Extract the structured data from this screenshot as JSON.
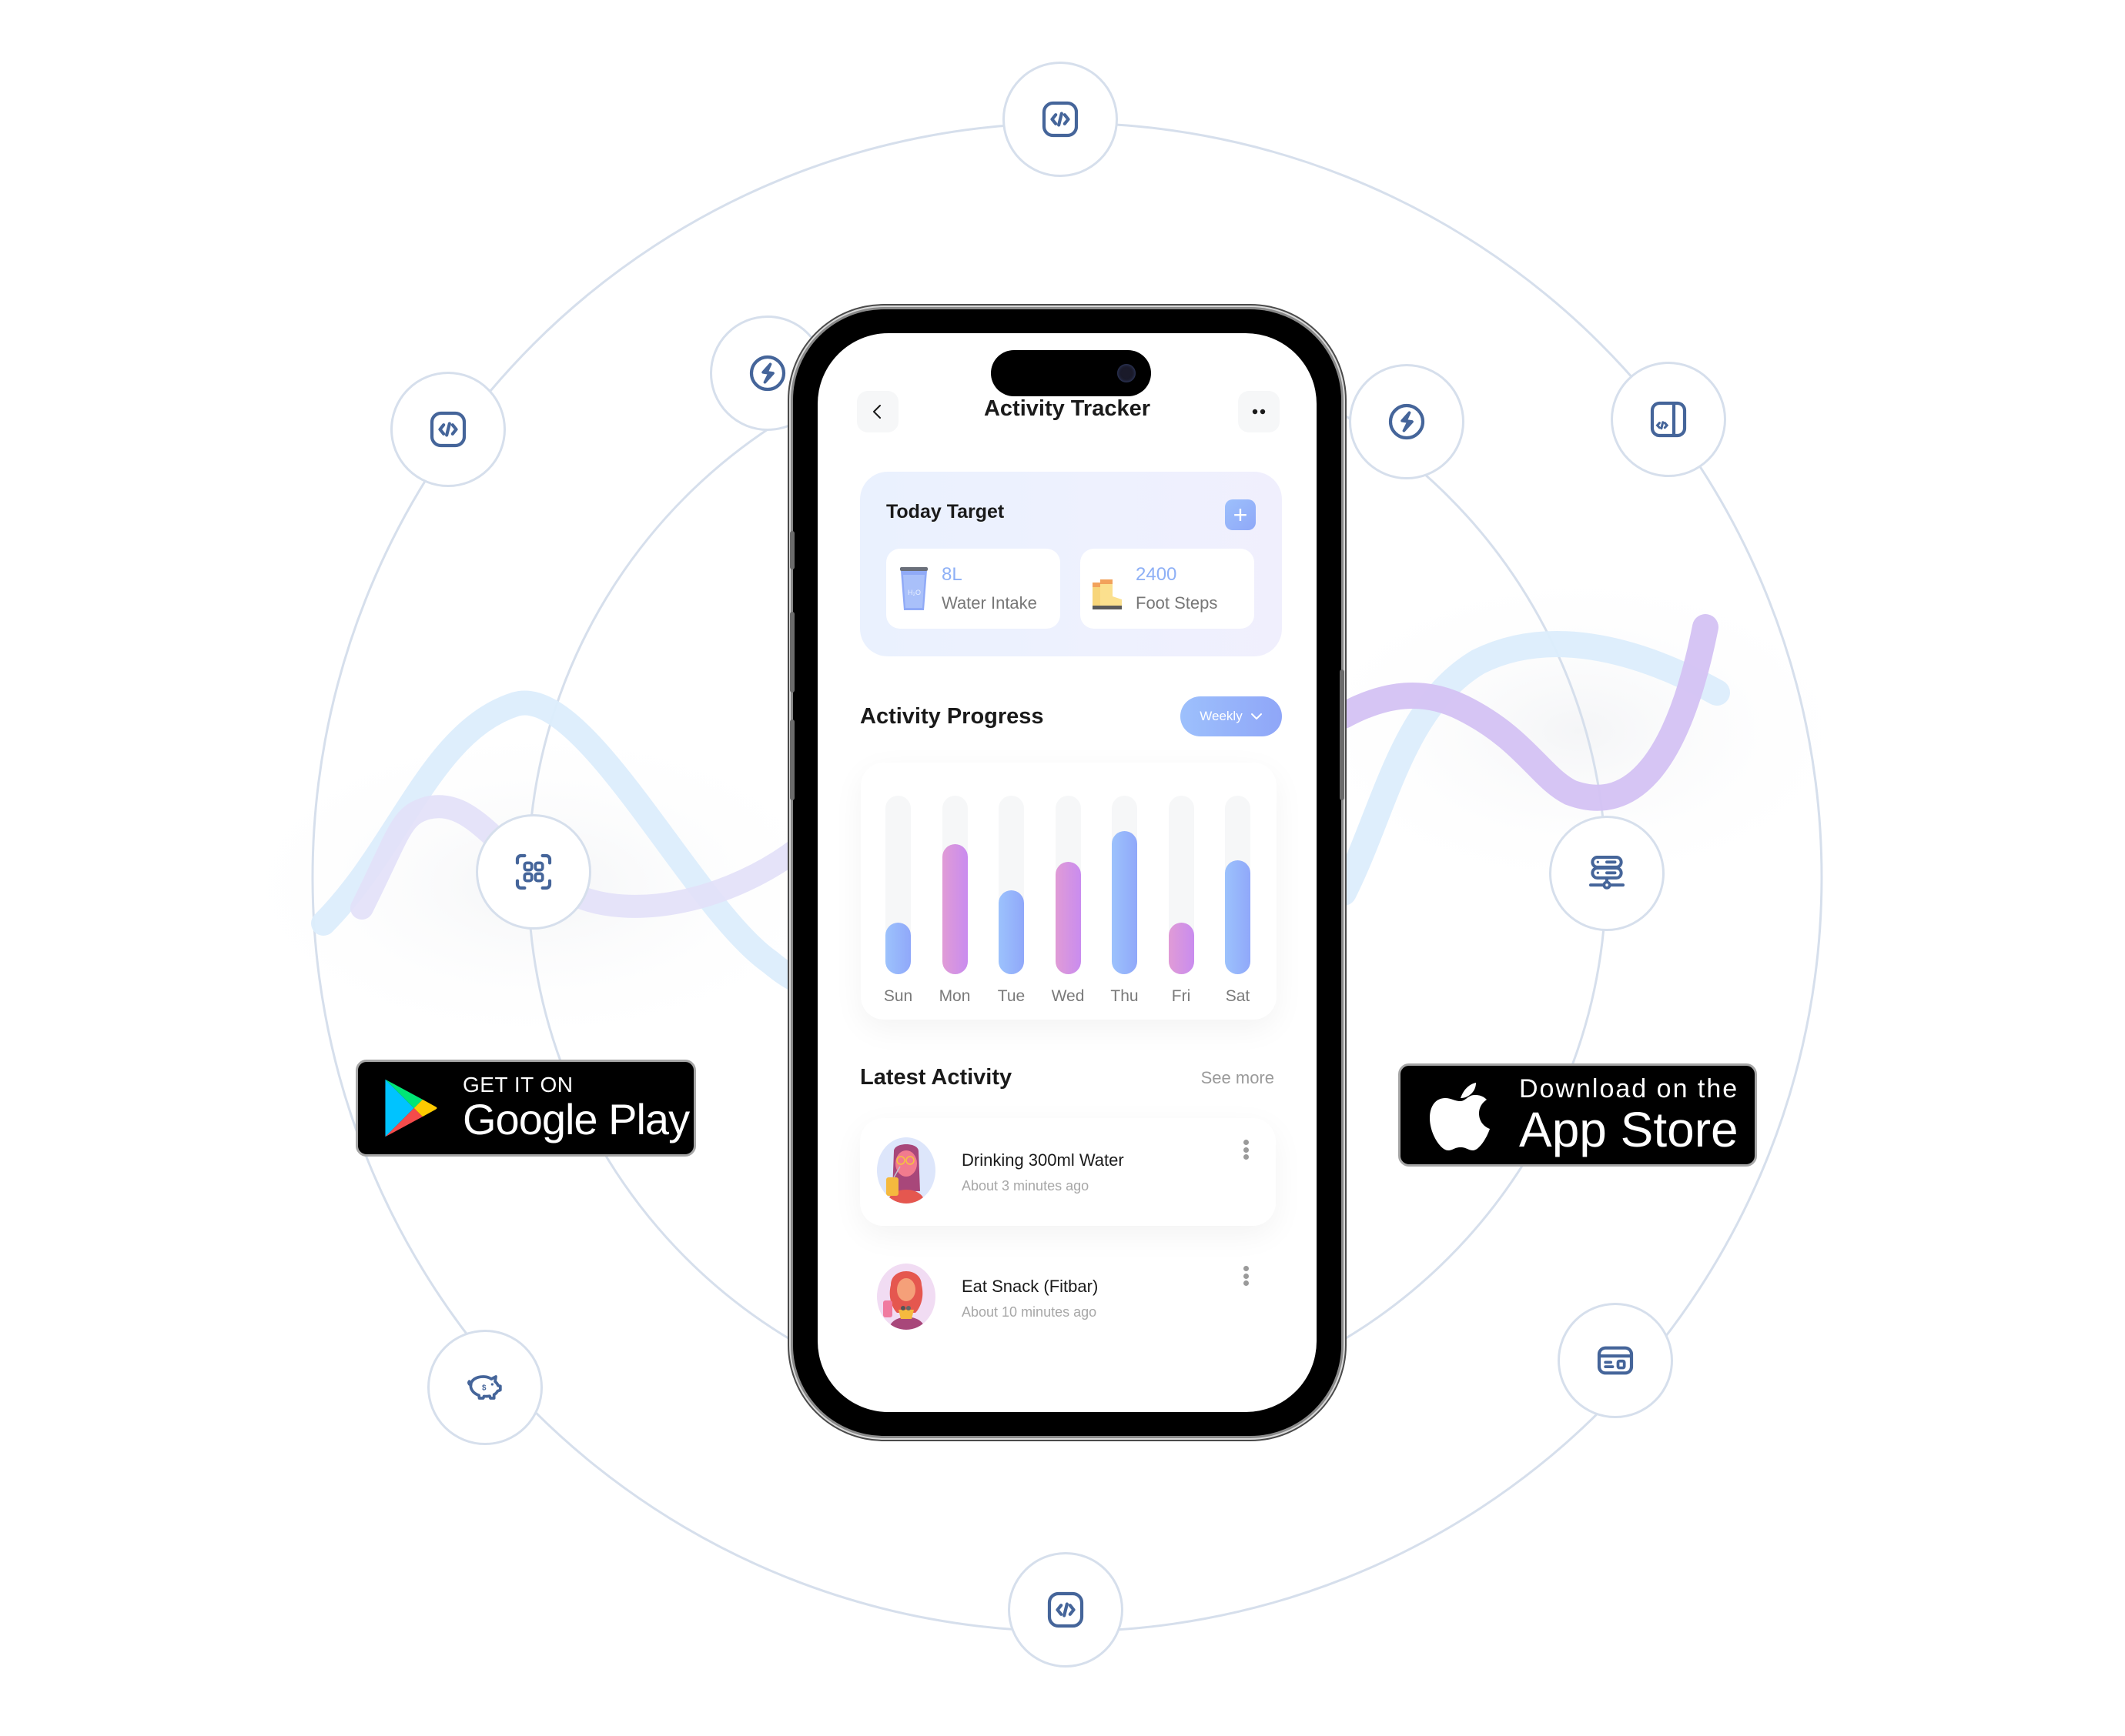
{
  "colors": {
    "accent_blue": "#8eb0f6",
    "accent_pink": "#d391e2",
    "orbit_line": "#d6dfec",
    "icon_stroke": "#45659a",
    "wave_blue": "#dcedfc",
    "wave_purple": "#d4c2f3"
  },
  "orbit_icons": [
    {
      "name": "code-icon",
      "position": "top"
    },
    {
      "name": "code-icon",
      "position": "upper-left"
    },
    {
      "name": "lightning-icon",
      "position": "inner-upper-left"
    },
    {
      "name": "lightning-icon",
      "position": "inner-upper-right"
    },
    {
      "name": "code-panel-icon",
      "position": "upper-right"
    },
    {
      "name": "grid-icon",
      "position": "inner-left"
    },
    {
      "name": "server-icon",
      "position": "inner-right"
    },
    {
      "name": "piggy-bank-icon",
      "position": "lower-left"
    },
    {
      "name": "credit-card-icon",
      "position": "lower-right"
    },
    {
      "name": "code-icon",
      "position": "bottom"
    }
  ],
  "badges": {
    "google_play": {
      "small": "GET IT ON",
      "big": "Google Play"
    },
    "app_store": {
      "small": "Download on the",
      "big": "App Store"
    }
  },
  "app": {
    "header": {
      "title": "Activity Tracker",
      "back_icon": "chevron-left-icon",
      "more_icon": "more-dots-icon"
    },
    "today_target": {
      "title": "Today Target",
      "add_icon": "plus-icon",
      "items": [
        {
          "value": "8L",
          "label": "Water Intake",
          "icon": "water-glass-icon"
        },
        {
          "value": "2400",
          "label": "Foot Steps",
          "icon": "boots-icon"
        }
      ]
    },
    "activity_progress": {
      "title": "Activity Progress",
      "period_select": "Weekly"
    },
    "latest_activity": {
      "title": "Latest Activity",
      "see_more": "See more",
      "items": [
        {
          "title": "Drinking 300ml Water",
          "time": "About 3 minutes ago"
        },
        {
          "title": "Eat Snack (Fitbar)",
          "time": "About 10 minutes ago"
        }
      ]
    }
  },
  "chart_data": {
    "type": "bar",
    "title": "Activity Progress",
    "categories": [
      "Sun",
      "Mon",
      "Tue",
      "Wed",
      "Thu",
      "Fri",
      "Sat"
    ],
    "values": [
      29,
      73,
      47,
      63,
      80,
      29,
      64
    ],
    "value_unit": "percent of daily track",
    "bar_colors": [
      "blue",
      "pink",
      "blue",
      "pink",
      "blue",
      "pink",
      "blue"
    ],
    "ylim": [
      0,
      100
    ],
    "xlabel": "",
    "ylabel": "",
    "grid": false,
    "legend": "none"
  }
}
